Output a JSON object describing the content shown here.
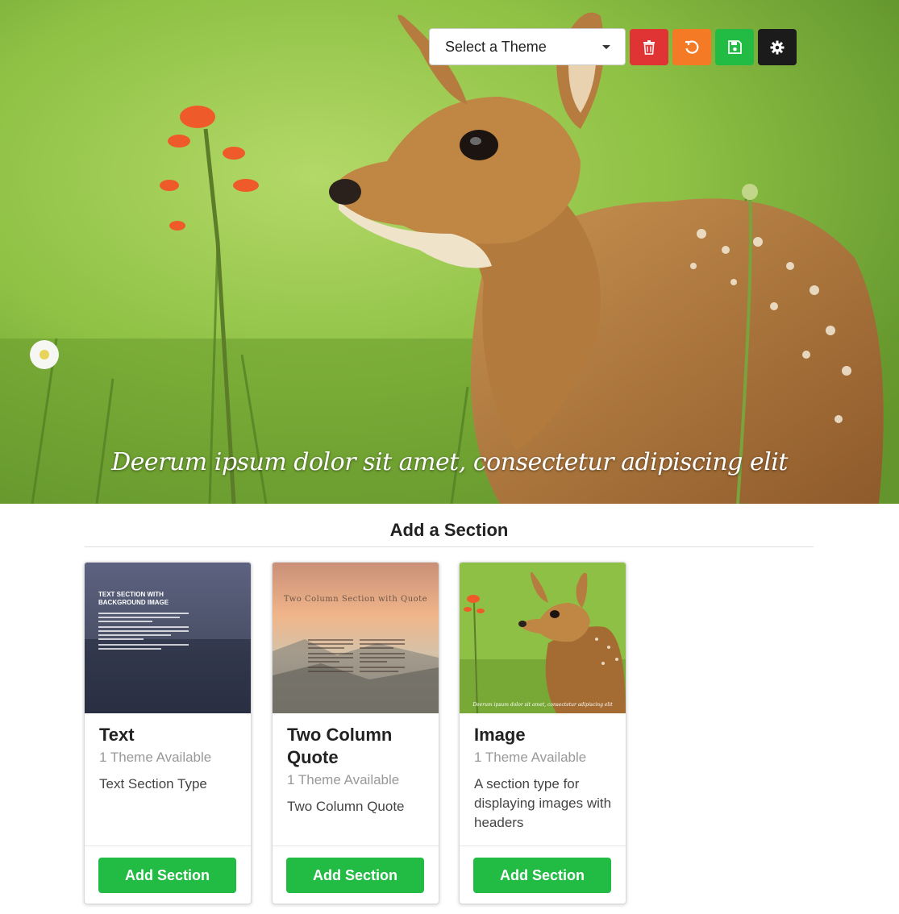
{
  "hero": {
    "caption": "Deerum ipsum dolor sit amet, consectetur adipiscing elit"
  },
  "toolbar": {
    "theme_select_label": "Select a Theme",
    "buttons": [
      {
        "name": "delete",
        "icon": "trash-icon",
        "color": "#e03434"
      },
      {
        "name": "reset",
        "icon": "undo-icon",
        "color": "#f47a25"
      },
      {
        "name": "save",
        "icon": "save-icon",
        "color": "#22bb44"
      },
      {
        "name": "settings",
        "icon": "gear-icon",
        "color": "#1b1b1b"
      }
    ]
  },
  "add_section": {
    "title": "Add a Section",
    "cards": [
      {
        "title": "Text",
        "themes": "1 Theme Available",
        "description": "Text Section Type",
        "button": "Add Section",
        "thumbnail_title": "Text section with background image"
      },
      {
        "title": "Two Column Quote",
        "themes": "1 Theme Available",
        "description": "Two Column Quote",
        "button": "Add Section",
        "thumbnail_title": "Two Column Section with Quote"
      },
      {
        "title": "Image",
        "themes": "1 Theme Available",
        "description": "A section type for displaying images with headers",
        "button": "Add Section",
        "thumbnail_caption": "Deerum ipsum dolor sit amet, consectetur adipiscing elit"
      }
    ]
  },
  "colors": {
    "primary_green": "#22bb44",
    "danger_red": "#e03434",
    "warning_orange": "#f47a25",
    "dark": "#1b1b1b"
  }
}
